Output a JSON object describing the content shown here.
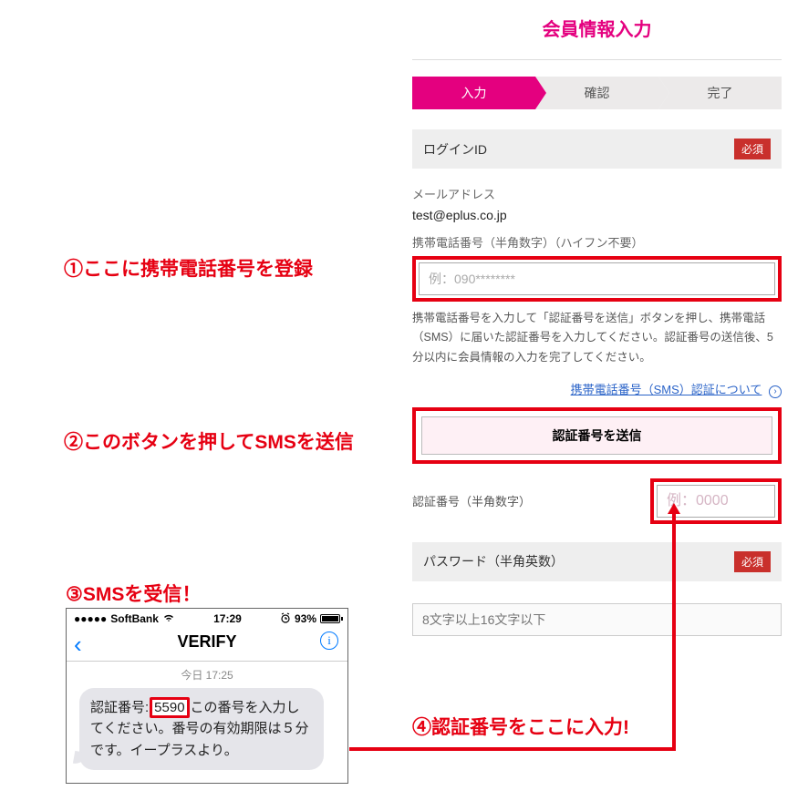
{
  "form": {
    "title": "会員情報入力",
    "steps": [
      "入力",
      "確認",
      "完了"
    ],
    "login_id_label": "ログインID",
    "required_badge": "必須",
    "email_label": "メールアドレス",
    "email_value": "test@eplus.co.jp",
    "phone_label": "携帯電話番号（半角数字）（ハイフン不要）",
    "phone_placeholder": "例：090********",
    "phone_help": "携帯電話番号を入力して「認証番号を送信」ボタンを押し、携帯電話（SMS）に届いた認証番号を入力してください。認証番号の送信後、5分以内に会員情報の入力を完了してください。",
    "sms_info_link": "携帯電話番号（SMS）認証について",
    "send_button": "認証番号を送信",
    "code_label": "認証番号（半角数字）",
    "code_placeholder": "例：0000",
    "password_label": "パスワード（半角英数）",
    "password_placeholder": "8文字以上16文字以下"
  },
  "annotations": {
    "a1": "①ここに携帯電話番号を登録",
    "a2": "②このボタンを押してSMSを送信",
    "a3": "③SMSを受信！",
    "a4": "④認証番号をここに入力!"
  },
  "sms": {
    "carrier": "SoftBank",
    "clock": "17:29",
    "battery": "93%",
    "title": "VERIFY",
    "timestamp": "今日 17:25",
    "msg_pre": "認証番号:",
    "code": "5590",
    "msg_post": "この番号を入力してください。番号の有効期限は５分です。イープラスより。"
  }
}
